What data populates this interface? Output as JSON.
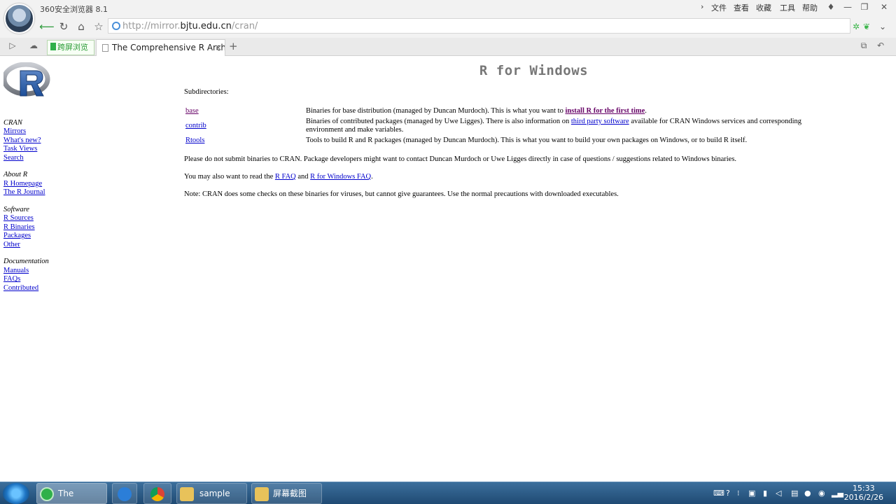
{
  "browser": {
    "app_title": "360安全浏览器 8.1",
    "menu": [
      "文件",
      "查看",
      "收藏",
      "工具",
      "帮助"
    ],
    "address": {
      "prefix": "http://mirror.",
      "domain": "bjtu.edu.cn",
      "path": "/cran/"
    },
    "green_tab_label": "跨屏浏览",
    "active_tab_title": "The Comprehensive R Archive"
  },
  "sidebar": {
    "groups": [
      {
        "title": "CRAN",
        "links": [
          "Mirrors",
          "What's new?",
          "Task Views",
          "Search"
        ]
      },
      {
        "title": "About R",
        "links": [
          "R Homepage",
          "The R Journal"
        ]
      },
      {
        "title": "Software",
        "links": [
          "R Sources",
          "R Binaries",
          "Packages",
          "Other"
        ]
      },
      {
        "title": "Documentation",
        "links": [
          "Manuals",
          "FAQs",
          "Contributed"
        ]
      }
    ]
  },
  "main": {
    "title": "R for Windows",
    "subdirectories_label": "Subdirectories:",
    "rows": [
      {
        "name": "base",
        "desc_pre": "Binaries for base distribution (managed by Duncan Murdoch). This is what you want to ",
        "link": "install R for the first time",
        "desc_post": "."
      },
      {
        "name": "contrib",
        "desc_pre": "Binaries of contributed packages (managed by Uwe Ligges). There is also information on ",
        "link": "third party software",
        "desc_post": " available for CRAN Windows services and corresponding environment and make variables."
      },
      {
        "name": "Rtools",
        "desc_pre": "Tools to build R and R packages (managed by Duncan Murdoch). This is what you want to build your own packages on Windows, or to build R itself.",
        "link": "",
        "desc_post": ""
      }
    ],
    "para_binaries": "Please do not submit binaries to CRAN. Package developers might want to contact Duncan Murdoch or Uwe Ligges directly in case of questions / suggestions related to Windows binaries.",
    "para_faq_pre": "You may also want to read the ",
    "para_faq_link1": "R FAQ",
    "para_faq_mid": " and ",
    "para_faq_link2": "R for Windows FAQ",
    "para_faq_post": ".",
    "para_note": "Note: CRAN does some checks on these binaries for viruses, but cannot give guarantees. Use the normal precautions with downloaded executables."
  },
  "taskbar": {
    "items": [
      "The Compr...",
      "sample",
      "屏幕截图"
    ],
    "time": "15:33",
    "date": "2016/2/26"
  }
}
